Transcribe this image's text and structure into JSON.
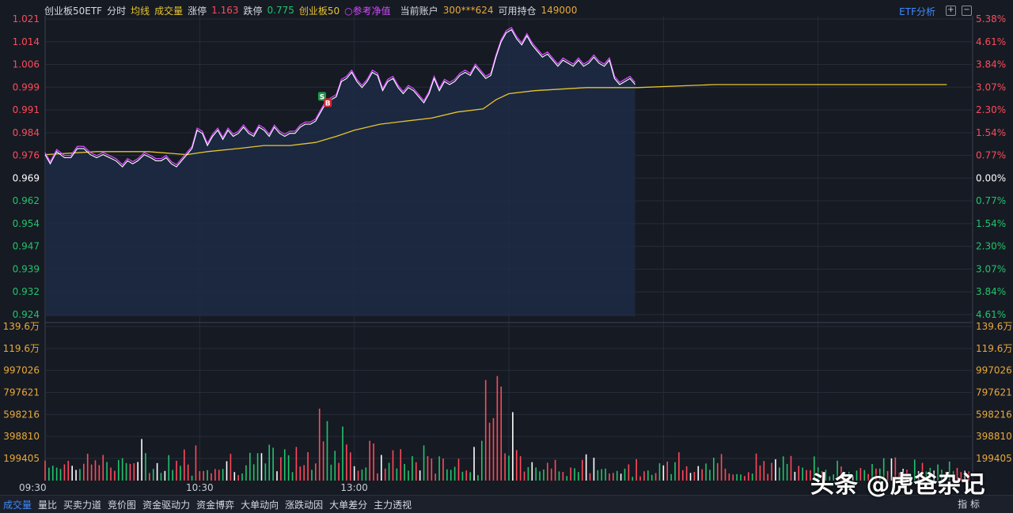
{
  "header": {
    "name": "创业板50ETF",
    "mode": "分时",
    "avg_line": "均线",
    "volume": "成交量",
    "limit_up_label": "涨停",
    "limit_up_value": "1.163",
    "limit_down_label": "跌停",
    "limit_down_value": "0.775",
    "index_name": "创业板50",
    "nav_label": "参考净值",
    "account_label": "当前账户",
    "account_value": "300***624",
    "position_label": "可用持仓",
    "position_value": "149000",
    "etf_analysis": "ETF分析"
  },
  "bottom_tabs": [
    "成交量",
    "量比",
    "买卖力道",
    "竞价图",
    "资金驱动力",
    "资金博弈",
    "大单动向",
    "涨跌动因",
    "大单差分",
    "主力透视"
  ],
  "bottom_right": "指 标",
  "watermark": "头条 @虎爸杂记",
  "colors": {
    "up": "#ff4a5a",
    "down": "#21c46b",
    "flat": "#ffffff",
    "price": "#ffffff",
    "nav": "#d24bff",
    "avg": "#e6c530",
    "accent": "#3f8cff"
  },
  "chart_data": {
    "type": "line",
    "x_ticks": [
      "09:30",
      "10:30",
      "13:00"
    ],
    "price_axis_left": [
      "1.021",
      "1.014",
      "1.006",
      "0.999",
      "0.991",
      "0.984",
      "0.976",
      "0.969",
      "0.962",
      "0.954",
      "0.947",
      "0.939",
      "0.932",
      "0.924"
    ],
    "price_axis_right": [
      "5.38%",
      "4.61%",
      "3.84%",
      "3.07%",
      "2.30%",
      "1.54%",
      "0.77%",
      "0.00%",
      "0.77%",
      "1.54%",
      "2.30%",
      "3.07%",
      "3.84%",
      "4.61%"
    ],
    "volume_axis_left": [
      "139.6万",
      "119.6万",
      "997026",
      "797621",
      "598216",
      "398810",
      "199405"
    ],
    "volume_axis_right": [
      "139.6万",
      "119.6万",
      "997026",
      "797621",
      "598216",
      "398810",
      "199405"
    ],
    "ylim_price": [
      0.924,
      1.021
    ],
    "ylim_volume": [
      0,
      1396000
    ],
    "trade_markers": [
      {
        "label": "S",
        "time": 215
      },
      {
        "label": "B",
        "time": 217
      }
    ],
    "price_series": [
      [
        0,
        0.977
      ],
      [
        4,
        0.974
      ],
      [
        9,
        0.978
      ],
      [
        15,
        0.976
      ],
      [
        20,
        0.976
      ],
      [
        25,
        0.979
      ],
      [
        30,
        0.979
      ],
      [
        35,
        0.977
      ],
      [
        40,
        0.976
      ],
      [
        45,
        0.977
      ],
      [
        50,
        0.976
      ],
      [
        55,
        0.975
      ],
      [
        60,
        0.973
      ],
      [
        64,
        0.975
      ],
      [
        68,
        0.974
      ],
      [
        72,
        0.975
      ],
      [
        77,
        0.977
      ],
      [
        82,
        0.976
      ],
      [
        86,
        0.975
      ],
      [
        90,
        0.975
      ],
      [
        94,
        0.976
      ],
      [
        98,
        0.974
      ],
      [
        102,
        0.973
      ],
      [
        106,
        0.975
      ],
      [
        110,
        0.977
      ],
      [
        114,
        0.979
      ],
      [
        118,
        0.985
      ],
      [
        122,
        0.984
      ],
      [
        126,
        0.98
      ],
      [
        130,
        0.983
      ],
      [
        134,
        0.985
      ],
      [
        138,
        0.982
      ],
      [
        142,
        0.985
      ],
      [
        146,
        0.983
      ],
      [
        150,
        0.984
      ],
      [
        154,
        0.986
      ],
      [
        158,
        0.984
      ],
      [
        162,
        0.983
      ],
      [
        166,
        0.986
      ],
      [
        170,
        0.985
      ],
      [
        174,
        0.983
      ],
      [
        178,
        0.986
      ],
      [
        182,
        0.984
      ],
      [
        186,
        0.983
      ],
      [
        190,
        0.984
      ],
      [
        194,
        0.984
      ],
      [
        198,
        0.986
      ],
      [
        202,
        0.987
      ],
      [
        206,
        0.987
      ],
      [
        210,
        0.988
      ],
      [
        214,
        0.991
      ],
      [
        218,
        0.994
      ],
      [
        222,
        0.995
      ],
      [
        226,
        0.996
      ],
      [
        230,
        1.001
      ],
      [
        234,
        1.002
      ],
      [
        238,
        1.004
      ],
      [
        242,
        1.001
      ],
      [
        246,
        0.999
      ],
      [
        250,
        1.001
      ],
      [
        254,
        1.004
      ],
      [
        258,
        1.003
      ],
      [
        262,
        0.998
      ],
      [
        266,
        1.001
      ],
      [
        270,
        1.002
      ],
      [
        274,
        0.999
      ],
      [
        278,
        0.997
      ],
      [
        282,
        0.999
      ],
      [
        286,
        0.998
      ],
      [
        290,
        0.996
      ],
      [
        294,
        0.994
      ],
      [
        298,
        0.997
      ],
      [
        302,
        1.002
      ],
      [
        306,
        0.998
      ],
      [
        310,
        1.001
      ],
      [
        314,
        1.0
      ],
      [
        318,
        1.001
      ],
      [
        322,
        1.003
      ],
      [
        326,
        1.004
      ],
      [
        330,
        1.003
      ],
      [
        334,
        1.006
      ],
      [
        338,
        1.004
      ],
      [
        342,
        1.002
      ],
      [
        346,
        1.003
      ],
      [
        350,
        1.009
      ],
      [
        354,
        1.014
      ],
      [
        358,
        1.017
      ],
      [
        362,
        1.018
      ],
      [
        366,
        1.015
      ],
      [
        370,
        1.013
      ],
      [
        374,
        1.016
      ],
      [
        378,
        1.013
      ],
      [
        382,
        1.011
      ],
      [
        386,
        1.009
      ],
      [
        390,
        1.01
      ],
      [
        394,
        1.008
      ],
      [
        398,
        1.006
      ],
      [
        402,
        1.008
      ],
      [
        406,
        1.007
      ],
      [
        410,
        1.006
      ],
      [
        414,
        1.008
      ],
      [
        418,
        1.006
      ],
      [
        422,
        1.007
      ],
      [
        426,
        1.009
      ],
      [
        430,
        1.007
      ],
      [
        434,
        1.006
      ],
      [
        438,
        1.008
      ],
      [
        442,
        1.002
      ],
      [
        446,
        1.0
      ],
      [
        450,
        1.001
      ],
      [
        454,
        1.002
      ],
      [
        458,
        1.0
      ]
    ],
    "nav_series_offset": 0.0007,
    "avg_series": [
      [
        0,
        0.977
      ],
      [
        40,
        0.978
      ],
      [
        80,
        0.978
      ],
      [
        110,
        0.977
      ],
      [
        126,
        0.978
      ],
      [
        150,
        0.979
      ],
      [
        170,
        0.98
      ],
      [
        190,
        0.98
      ],
      [
        210,
        0.981
      ],
      [
        226,
        0.983
      ],
      [
        240,
        0.985
      ],
      [
        260,
        0.987
      ],
      [
        280,
        0.988
      ],
      [
        300,
        0.989
      ],
      [
        320,
        0.991
      ],
      [
        340,
        0.992
      ],
      [
        350,
        0.995
      ],
      [
        360,
        0.997
      ],
      [
        380,
        0.998
      ],
      [
        420,
        0.999
      ],
      [
        460,
        0.999
      ],
      [
        520,
        1.0
      ],
      [
        600,
        1.0
      ],
      [
        700,
        1.0
      ]
    ]
  }
}
